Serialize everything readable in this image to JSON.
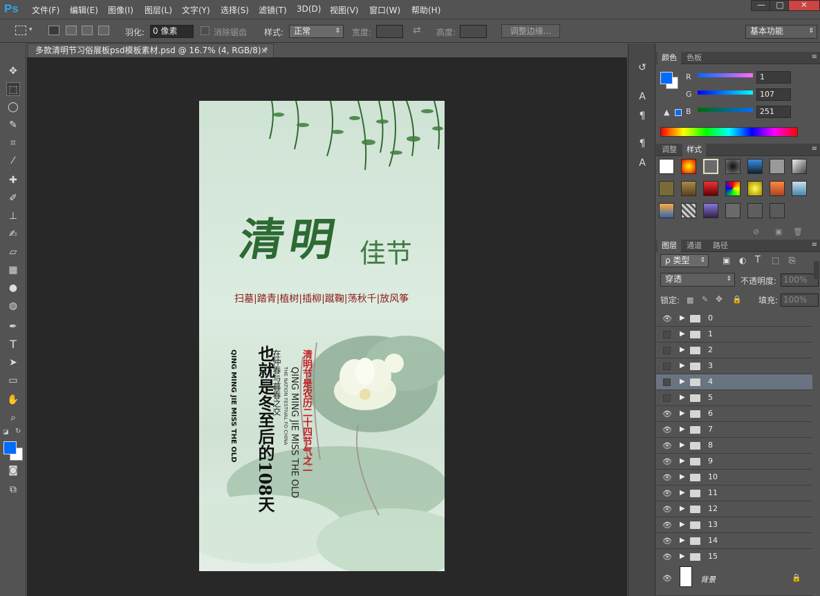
{
  "app": {
    "logo": "Ps",
    "window_controls": [
      "—",
      "□",
      "✕"
    ]
  },
  "menu": [
    "文件(F)",
    "编辑(E)",
    "图像(I)",
    "图层(L)",
    "文字(Y)",
    "选择(S)",
    "滤镜(T)",
    "3D(D)",
    "视图(V)",
    "窗口(W)",
    "帮助(H)"
  ],
  "options": {
    "feather_label": "羽化:",
    "feather_value": "0 像素",
    "antialias_label": "消除锯齿",
    "style_label": "样式:",
    "style_value": "正常",
    "width_label": "宽度:",
    "height_label": "高度:",
    "refine_button": "调整边缘...",
    "workspace": "基本功能"
  },
  "document": {
    "tab_title": "多款清明节习俗展板psd模板素材.psd @ 16.7% (4, RGB/8) *",
    "close": "×"
  },
  "poster": {
    "title_main": "清明",
    "title_sub": "佳节",
    "customs": "扫墓|踏青|植树|插柳|蹴鞠|荡秋千|放风筝",
    "vertical_big": "也就是冬至后的108天",
    "vertical_small": "在仲春与暮春之交",
    "vertical_red": "清明节是农历二十四节气之一",
    "vertical_en1": "QING MING JIE MISS THE OLD",
    "vertical_en2": "THE NATION FESTIVAL FO CHINA",
    "vertical_en3": "QING MING JIE MISS THE OLD"
  },
  "panels": {
    "color_tabs": [
      "颜色",
      "色板"
    ],
    "rgb": [
      {
        "label": "R",
        "value": "1"
      },
      {
        "label": "G",
        "value": "107"
      },
      {
        "label": "B",
        "value": "251"
      }
    ],
    "fg_color": "#016bfb",
    "style_tabs": [
      "调整",
      "样式"
    ],
    "layer_tabs": [
      "图层",
      "通道",
      "路径"
    ],
    "filter_kind": "ρ 类型",
    "blend_mode": "穿透",
    "opacity_label": "不透明度:",
    "opacity_value": "100%",
    "lock_label": "锁定:",
    "fill_label": "填充:",
    "fill_value": "100%",
    "layers": [
      {
        "name": "0",
        "visible": true
      },
      {
        "name": "1",
        "visible": false
      },
      {
        "name": "2",
        "visible": false
      },
      {
        "name": "3",
        "visible": false
      },
      {
        "name": "4",
        "visible": false,
        "selected": true
      },
      {
        "name": "5",
        "visible": false
      },
      {
        "name": "6",
        "visible": true
      },
      {
        "name": "7",
        "visible": true
      },
      {
        "name": "8",
        "visible": true
      },
      {
        "name": "9",
        "visible": true
      },
      {
        "name": "10",
        "visible": true
      },
      {
        "name": "11",
        "visible": true
      },
      {
        "name": "12",
        "visible": true
      },
      {
        "name": "13",
        "visible": true
      },
      {
        "name": "14",
        "visible": true
      },
      {
        "name": "15",
        "visible": true
      }
    ],
    "background_layer": "背景"
  }
}
